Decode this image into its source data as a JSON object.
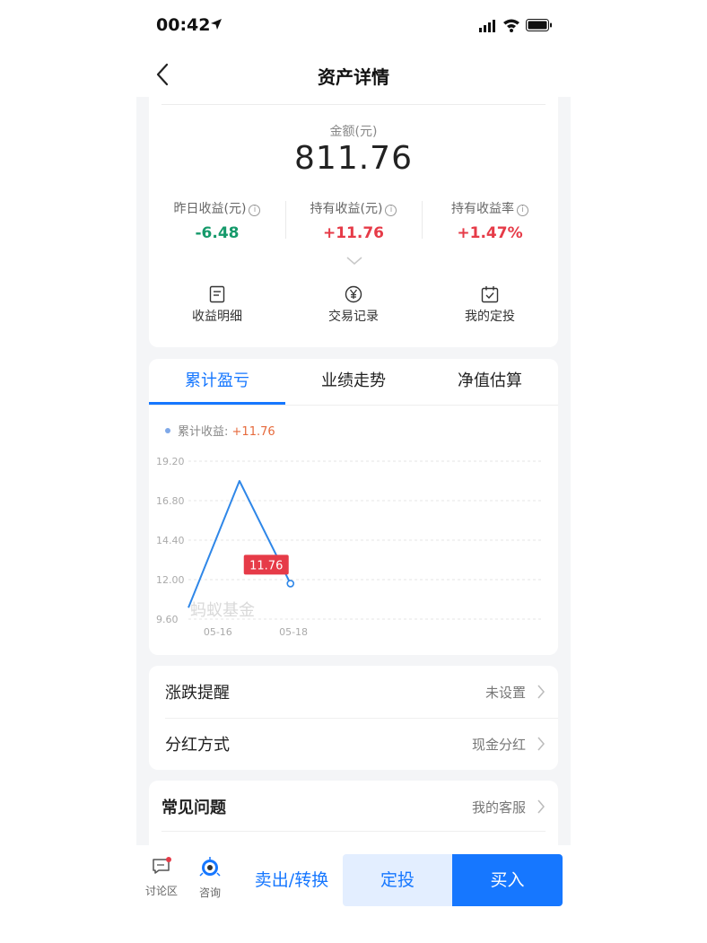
{
  "status": {
    "time": "00:42"
  },
  "nav": {
    "title": "资产详情"
  },
  "amount": {
    "label": "金额(元)",
    "value": "811.76"
  },
  "stats": [
    {
      "label": "昨日收益(元)",
      "value": "-6.48"
    },
    {
      "label": "持有收益(元)",
      "value": "+11.76"
    },
    {
      "label": "持有收益率",
      "value": "+1.47%"
    }
  ],
  "info_glyph": "i",
  "actions": [
    {
      "label": "收益明细",
      "icon": "document-icon"
    },
    {
      "label": "交易记录",
      "icon": "yuan-icon"
    },
    {
      "label": "我的定投",
      "icon": "calendar-check-icon"
    }
  ],
  "tabs": [
    "累计盈亏",
    "业绩走势",
    "净值估算"
  ],
  "chart_legend": {
    "label": "累计收益:",
    "value": "+11.76"
  },
  "chart_data": {
    "type": "line",
    "series": [
      {
        "name": "累计收益",
        "points": [
          [
            0,
            10.3
          ],
          [
            0.675,
            18.0
          ],
          [
            1.35,
            11.76
          ]
        ]
      }
    ],
    "ylim": [
      9.6,
      19.2
    ],
    "yticks": [
      "19.20",
      "16.80",
      "14.40",
      "12.00",
      "9.60"
    ],
    "xticks": [
      "05-16",
      "05-18"
    ],
    "xtick_positions": [
      0.2,
      1.2
    ],
    "xlim": [
      0,
      4.7
    ],
    "tooltip": "11.76",
    "watermark": "蚂蚁基金",
    "grid": true
  },
  "settings": [
    {
      "label": "涨跌提醒",
      "value": "未设置"
    },
    {
      "label": "分红方式",
      "value": "现金分红"
    }
  ],
  "faq": {
    "title": "常见问题",
    "link": "我的客服"
  },
  "bottom": {
    "forum": "讨论区",
    "consult": "咨询",
    "sell": "卖出/转换",
    "auto_invest": "定投",
    "buy": "买入"
  },
  "colors": {
    "accent": "#1677ff",
    "up": "#e63b48",
    "down": "#169a6b"
  }
}
